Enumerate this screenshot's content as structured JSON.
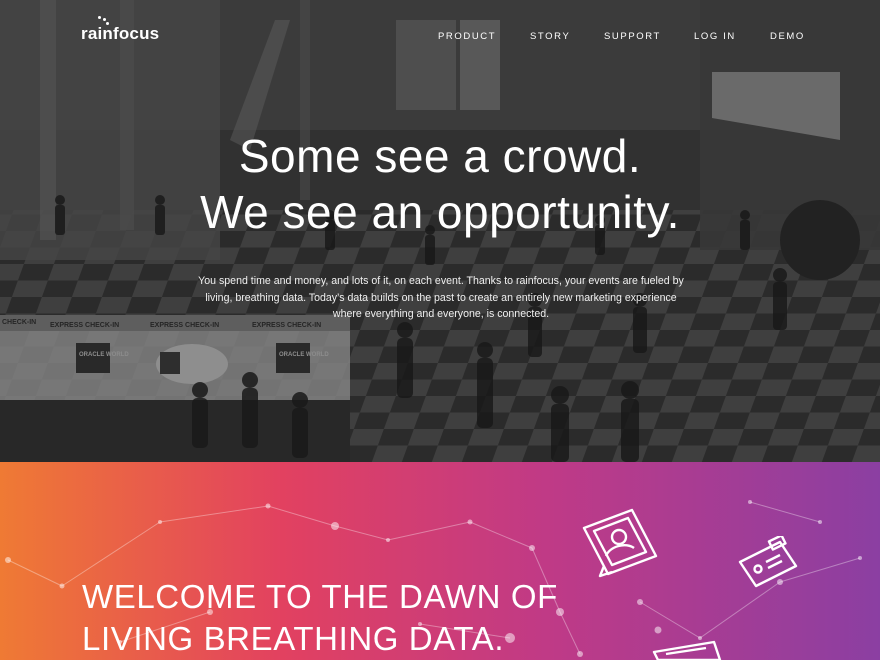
{
  "brand": {
    "logo_text": "rainfocus"
  },
  "nav": {
    "items": [
      "PRODUCT",
      "STORY",
      "SUPPORT",
      "LOG IN",
      "DEMO"
    ]
  },
  "hero": {
    "headline_line1": "Some see a crowd.",
    "headline_line2": "We see an opportunity.",
    "intro_line1": "You spend time and money, and lots of it, on each event. Thanks to rainfocus, your events are fueled by",
    "intro_line2": "living, breathing data. Today’s data builds on the past to create an entirely new marketing experience",
    "intro_line3": "where everything and everyone, is connected.",
    "photo_signs": {
      "express_checkin_1": "EXPRESS CHECK-IN",
      "express_checkin_2": "EXPRESS CHECK-IN",
      "express_checkin_3": "EXPRESS CHECK-IN",
      "checkin_left": "CHECK-IN",
      "oracle_world_1": "ORACLE WORLD",
      "oracle_world_2": "ORACLE WORLD"
    }
  },
  "welcome": {
    "title_line1": "WELCOME TO THE DAWN OF",
    "title_line2": "LIVING BREATHING DATA."
  },
  "colors": {
    "gradient_start": "#ef7a34",
    "gradient_mid1": "#e24160",
    "gradient_mid2": "#c03a86",
    "gradient_end": "#8b3fa2"
  },
  "icons": [
    "person-card-icon",
    "id-badge-icon",
    "screen-icon"
  ]
}
